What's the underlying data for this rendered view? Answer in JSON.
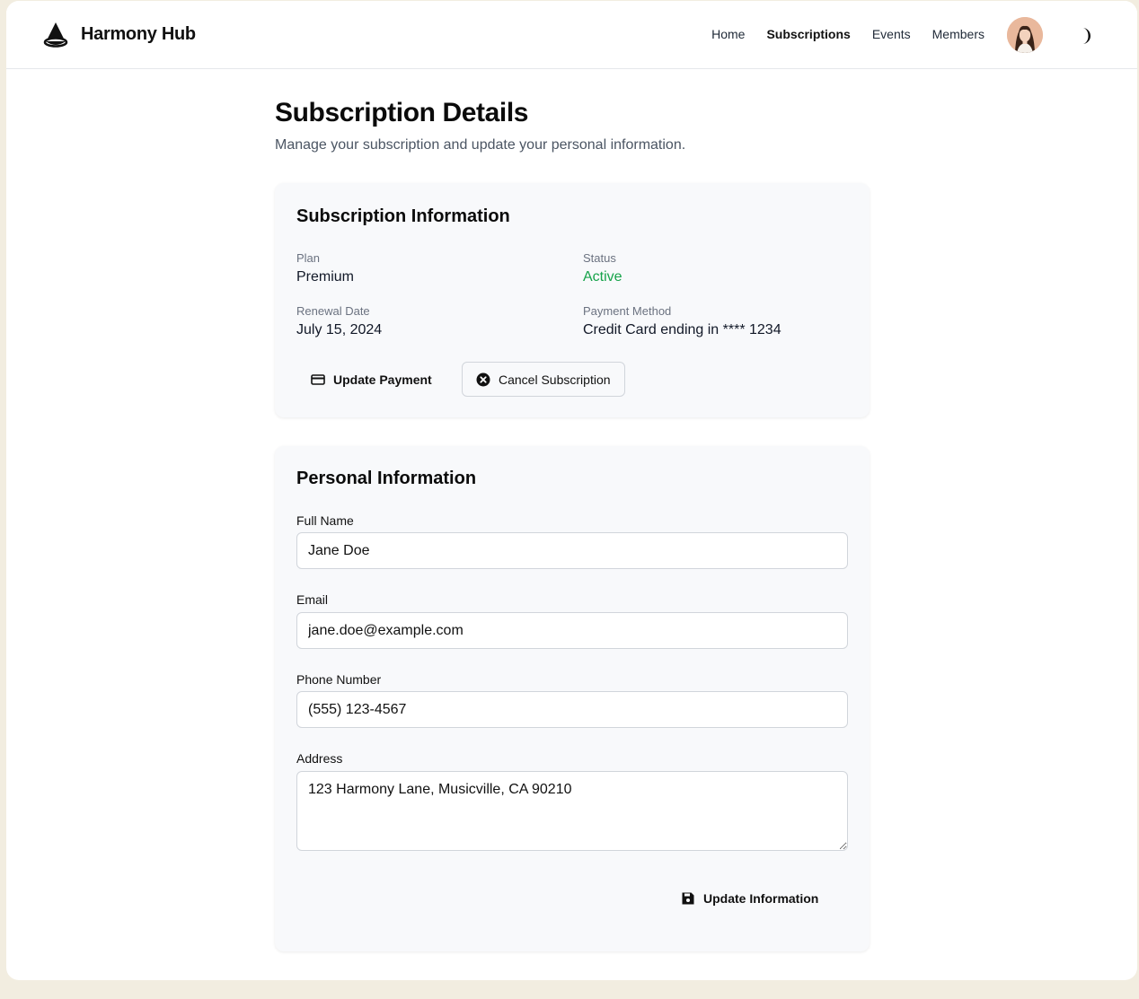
{
  "app": {
    "name": "Harmony Hub"
  },
  "nav": {
    "items": [
      {
        "label": "Home"
      },
      {
        "label": "Subscriptions",
        "active": true
      },
      {
        "label": "Events"
      },
      {
        "label": "Members"
      }
    ]
  },
  "page": {
    "title": "Subscription Details",
    "subtitle": "Manage your subscription and update your personal information."
  },
  "subscription": {
    "title": "Subscription Information",
    "plan": {
      "label": "Plan",
      "value": "Premium"
    },
    "status": {
      "label": "Status",
      "value": "Active",
      "color": "#16a34a"
    },
    "renewal": {
      "label": "Renewal Date",
      "value": "July 15, 2024"
    },
    "payment": {
      "label": "Payment Method",
      "value": "Credit Card ending in **** 1234"
    },
    "update_payment_label": "Update Payment",
    "cancel_label": "Cancel Subscription"
  },
  "personal": {
    "title": "Personal Information",
    "full_name": {
      "label": "Full Name",
      "value": "Jane Doe"
    },
    "email": {
      "label": "Email",
      "value": "jane.doe@example.com"
    },
    "phone": {
      "label": "Phone Number",
      "value": "(555) 123-4567"
    },
    "address": {
      "label": "Address",
      "value": "123 Harmony Lane, Musicville, CA 90210"
    },
    "submit_label": "Update Information"
  },
  "icons": {
    "logo": "cone-logo-icon",
    "theme": "moon-icon",
    "payment": "credit-card-icon",
    "cancel": "x-circle-icon",
    "save": "floppy-disk-icon"
  },
  "colors": {
    "page_bg": "#f2ede0",
    "card_bg": "#f8f9fb",
    "status_active": "#16a34a"
  }
}
